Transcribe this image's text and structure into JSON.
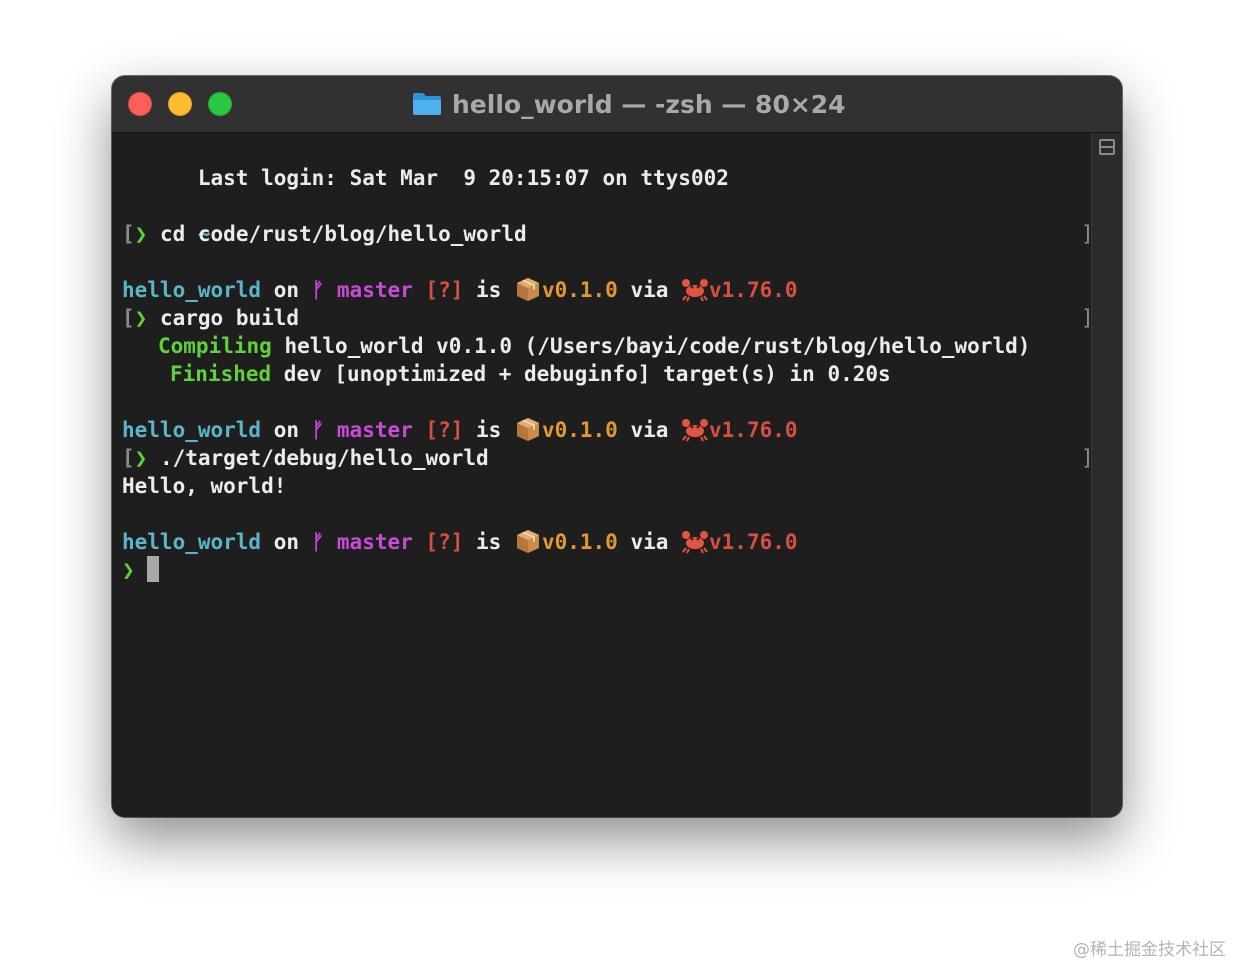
{
  "window": {
    "title": "hello_world — -zsh — 80×24",
    "folder_icon": "folder-icon",
    "colors": {
      "close": "#fe5f57",
      "minimize": "#febc2e",
      "zoom": "#28c840"
    }
  },
  "terminal": {
    "last_login": "Last login: Sat Mar  9 20:15:07 on ttys002",
    "home_tilde": "~",
    "prompt_char": "❯",
    "bracket_left": "[",
    "bracket_right": "]",
    "cmd1": " cd code/rust/blog/hello_world",
    "prompt": {
      "dir": "hello_world",
      "on": " on ",
      "branch_icon": "ᚠ",
      "branch": " master",
      "status": " [?]",
      "is": " is ",
      "version": "v0.1.0",
      "via": " via ",
      "rust_version": "v1.76.0"
    },
    "cmd2": " cargo build",
    "compiling_label": "Compiling",
    "compiling_rest": " hello_world v0.1.0 (/Users/bayi/code/rust/blog/hello_world)",
    "finished_label": "Finished",
    "finished_rest": " dev [unoptimized + debuginfo] target(s) in 0.20s",
    "cmd3": " ./target/debug/hello_world",
    "output": "Hello, world!"
  },
  "watermark": "@稀土掘金技术社区",
  "colors": {
    "dir": "#59b6c9",
    "prompt_arrow": "#5fd23a",
    "branch": "#c84ad6",
    "status": "#d64f3f",
    "version": "#e0982f",
    "rust_version": "#d64f3f",
    "compiling": "#5fd23a"
  }
}
